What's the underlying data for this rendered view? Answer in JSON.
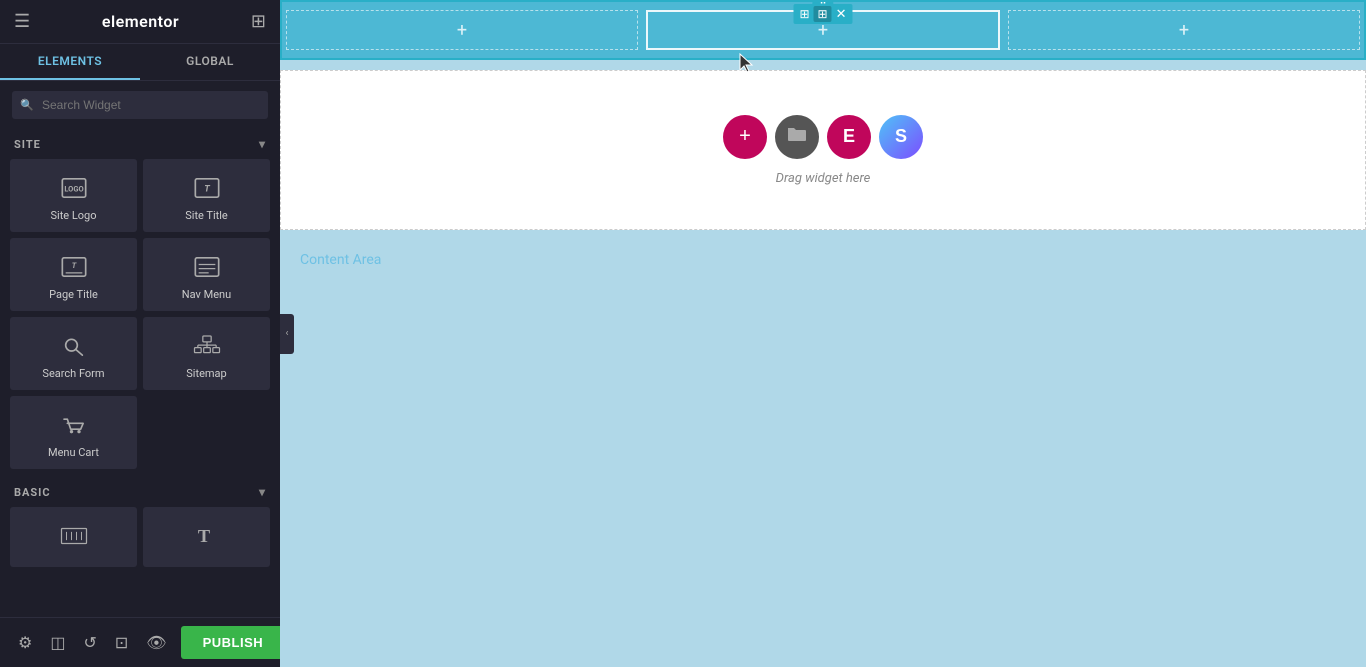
{
  "header": {
    "hamburger_label": "☰",
    "title": "elementor",
    "grid_icon": "⊞"
  },
  "tabs": {
    "elements_label": "ELEMENTS",
    "global_label": "GLOBAL"
  },
  "search": {
    "placeholder": "Search Widget"
  },
  "site_section": {
    "label": "SITE",
    "chevron": "▾"
  },
  "widgets": [
    {
      "id": "site-logo",
      "label": "Site Logo",
      "icon": "logo"
    },
    {
      "id": "site-title",
      "label": "Site Title",
      "icon": "title"
    },
    {
      "id": "page-title",
      "label": "Page Title",
      "icon": "page-title"
    },
    {
      "id": "nav-menu",
      "label": "Nav Menu",
      "icon": "nav-menu"
    },
    {
      "id": "search-form",
      "label": "Search Form",
      "icon": "search-form"
    },
    {
      "id": "sitemap",
      "label": "Sitemap",
      "icon": "sitemap"
    },
    {
      "id": "menu-cart",
      "label": "Menu Cart",
      "icon": "menu-cart"
    }
  ],
  "basic_section": {
    "label": "BASIC",
    "chevron": "▾"
  },
  "toolbar": {
    "settings_icon": "⚙",
    "layers_icon": "◫",
    "history_icon": "↺",
    "responsive_icon": "⊡",
    "preview_icon": "👁",
    "publish_label": "PUBLISH",
    "arrow_label": "▲"
  },
  "canvas": {
    "drag_text": "Drag widget here",
    "content_area_label": "Content Area",
    "add_icon": "+",
    "folder_icon": "📁",
    "e_label": "E",
    "s_label": "S"
  }
}
